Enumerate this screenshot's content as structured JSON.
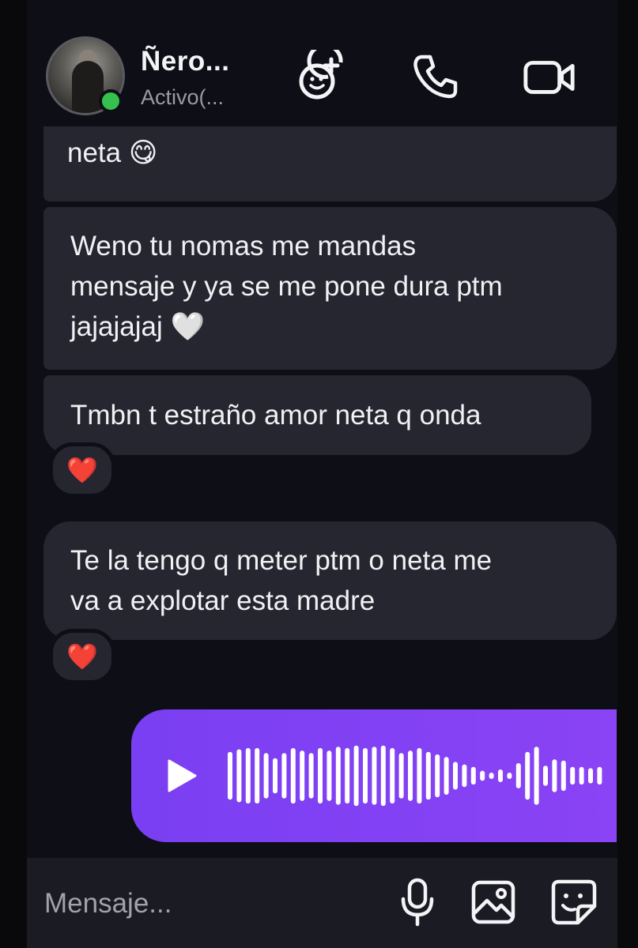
{
  "header": {
    "contact_name": "Ñero...",
    "status": "Activo(...",
    "icons": [
      "group-add-icon",
      "phone-icon",
      "video-icon"
    ]
  },
  "messages": [
    {
      "text": "neta 😋",
      "reaction": null
    },
    {
      "text_lines": [
        "Weno tu nomas me mandas",
        "mensaje y ya se me pone dura ptm",
        "jajajajaj 🤍"
      ],
      "reaction": null
    },
    {
      "text": "Tmbn t estraño amor neta q onda",
      "reaction": "❤️"
    },
    {
      "text_lines": [
        "Te la tengo q meter ptm o neta me",
        "va a explotar esta madre"
      ],
      "reaction": "❤️"
    }
  ],
  "voice_message": {
    "icon": "play-icon",
    "waveform_levels": [
      0.38,
      0.42,
      0.44,
      0.44,
      0.36,
      0.28,
      0.36,
      0.44,
      0.4,
      0.36,
      0.44,
      0.4,
      0.46,
      0.44,
      0.48,
      0.44,
      0.46,
      0.48,
      0.44,
      0.36,
      0.4,
      0.44,
      0.38,
      0.34,
      0.3,
      0.22,
      0.18,
      0.14,
      0.08,
      0.05,
      0.1,
      0.05,
      0.2,
      0.38,
      0.46,
      0.16,
      0.26,
      0.24,
      0.14,
      0.14,
      0.12,
      0.14
    ]
  },
  "composer": {
    "placeholder": "Mensaje...",
    "icons": [
      "microphone-icon",
      "image-icon",
      "sticker-icon"
    ]
  },
  "colors": {
    "accent": "#8a43f5",
    "bubble": "#262631",
    "background": "#0d0e16",
    "online": "#34c14d"
  }
}
